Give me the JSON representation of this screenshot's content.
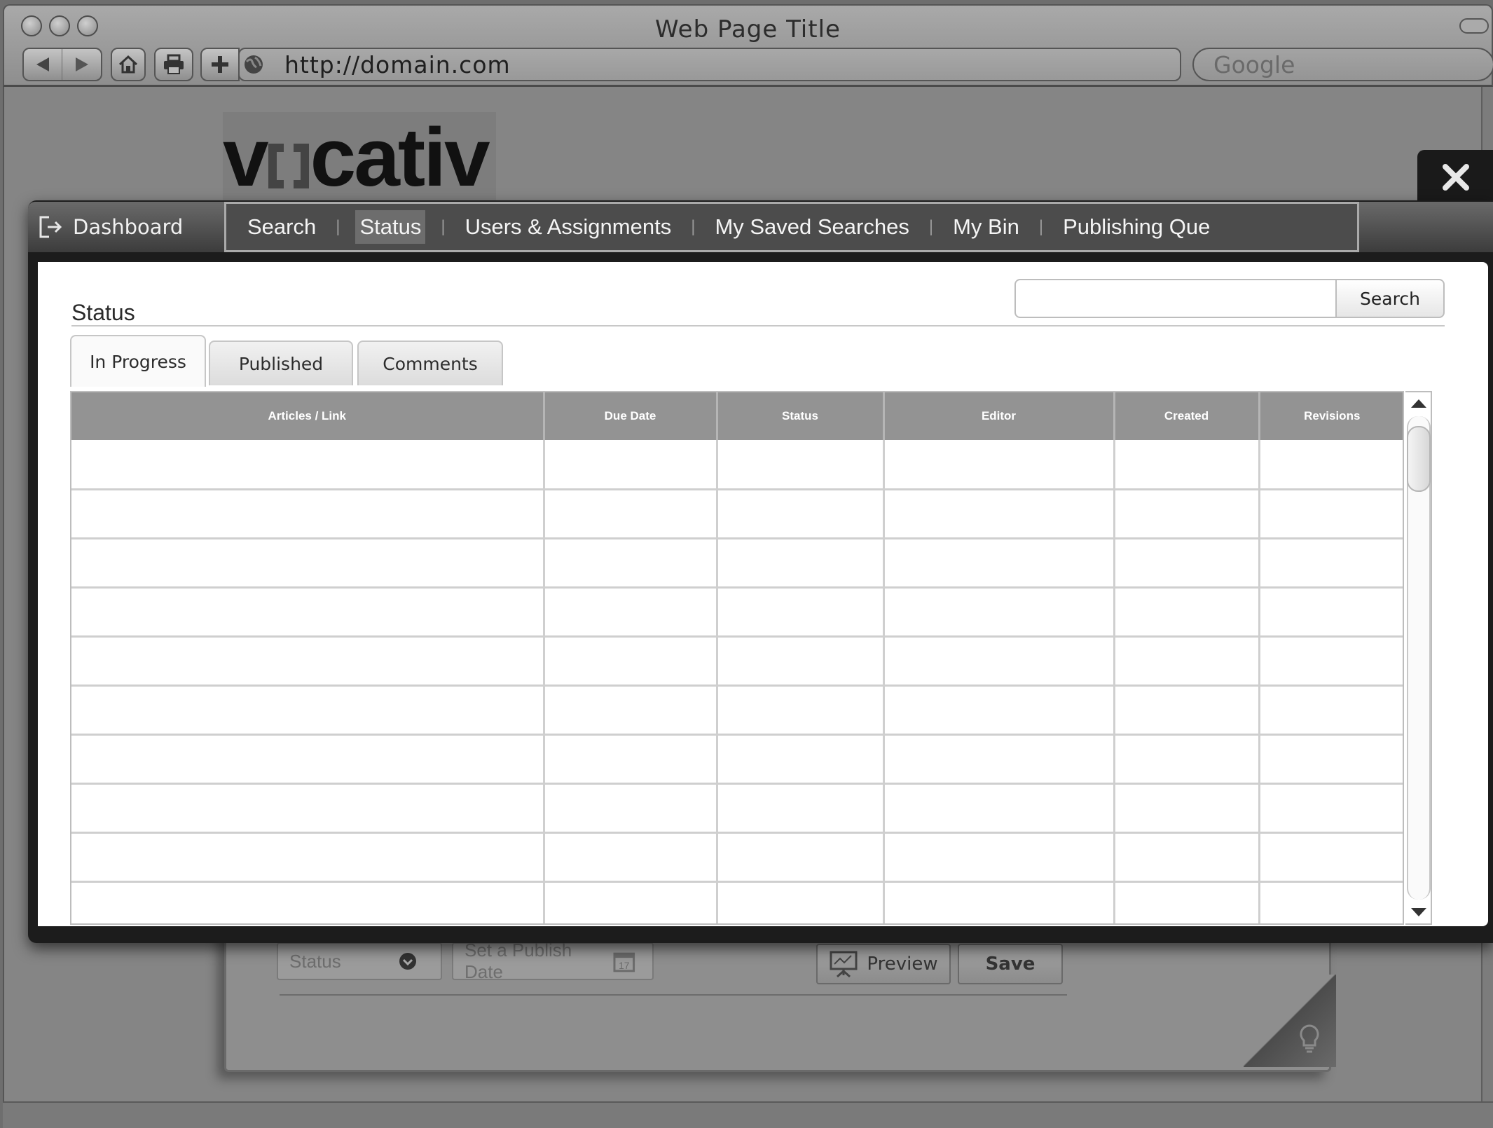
{
  "browser": {
    "window_title": "Web Page Title",
    "url": "http://domain.com",
    "search_placeholder": "Google"
  },
  "page": {
    "logo_text_left": "v",
    "logo_text_right": "cativ"
  },
  "modal": {
    "dashboard_label": "Dashboard",
    "nav_tabs": [
      {
        "label": "Search",
        "active": false
      },
      {
        "label": "Status",
        "active": true
      },
      {
        "label": "Users & Assignments",
        "active": false
      },
      {
        "label": "My Saved Searches",
        "active": false
      },
      {
        "label": "My Bin",
        "active": false
      },
      {
        "label": "Publishing Que",
        "active": false
      }
    ],
    "heading": "Status",
    "search_button": "Search",
    "search_value": "",
    "tabs": [
      {
        "label": "In Progress",
        "active": true
      },
      {
        "label": "Published",
        "active": false
      },
      {
        "label": "Comments",
        "active": false
      }
    ],
    "table": {
      "columns": [
        "Articles / Link",
        "Due Date",
        "Status",
        "Editor",
        "Created",
        "Revisions"
      ],
      "rows": [
        [
          "",
          "",
          "",
          "",
          "",
          ""
        ],
        [
          "",
          "",
          "",
          "",
          "",
          ""
        ],
        [
          "",
          "",
          "",
          "",
          "",
          ""
        ],
        [
          "",
          "",
          "",
          "",
          "",
          ""
        ],
        [
          "",
          "",
          "",
          "",
          "",
          ""
        ],
        [
          "",
          "",
          "",
          "",
          "",
          ""
        ],
        [
          "",
          "",
          "",
          "",
          "",
          ""
        ],
        [
          "",
          "",
          "",
          "",
          "",
          ""
        ],
        [
          "",
          "",
          "",
          "",
          "",
          ""
        ],
        [
          "",
          "",
          "",
          "",
          "",
          ""
        ]
      ]
    }
  },
  "background_form": {
    "status_select": "Status",
    "publish_date_placeholder": "Set a Publish Date",
    "calendar_day": "17",
    "preview_label": "Preview",
    "save_label": "Save"
  },
  "colors": {
    "overlay": "#858585",
    "modal_frame": "#1c1c1c",
    "table_header": "#939393",
    "nav_bar": "#4c4c4c"
  }
}
